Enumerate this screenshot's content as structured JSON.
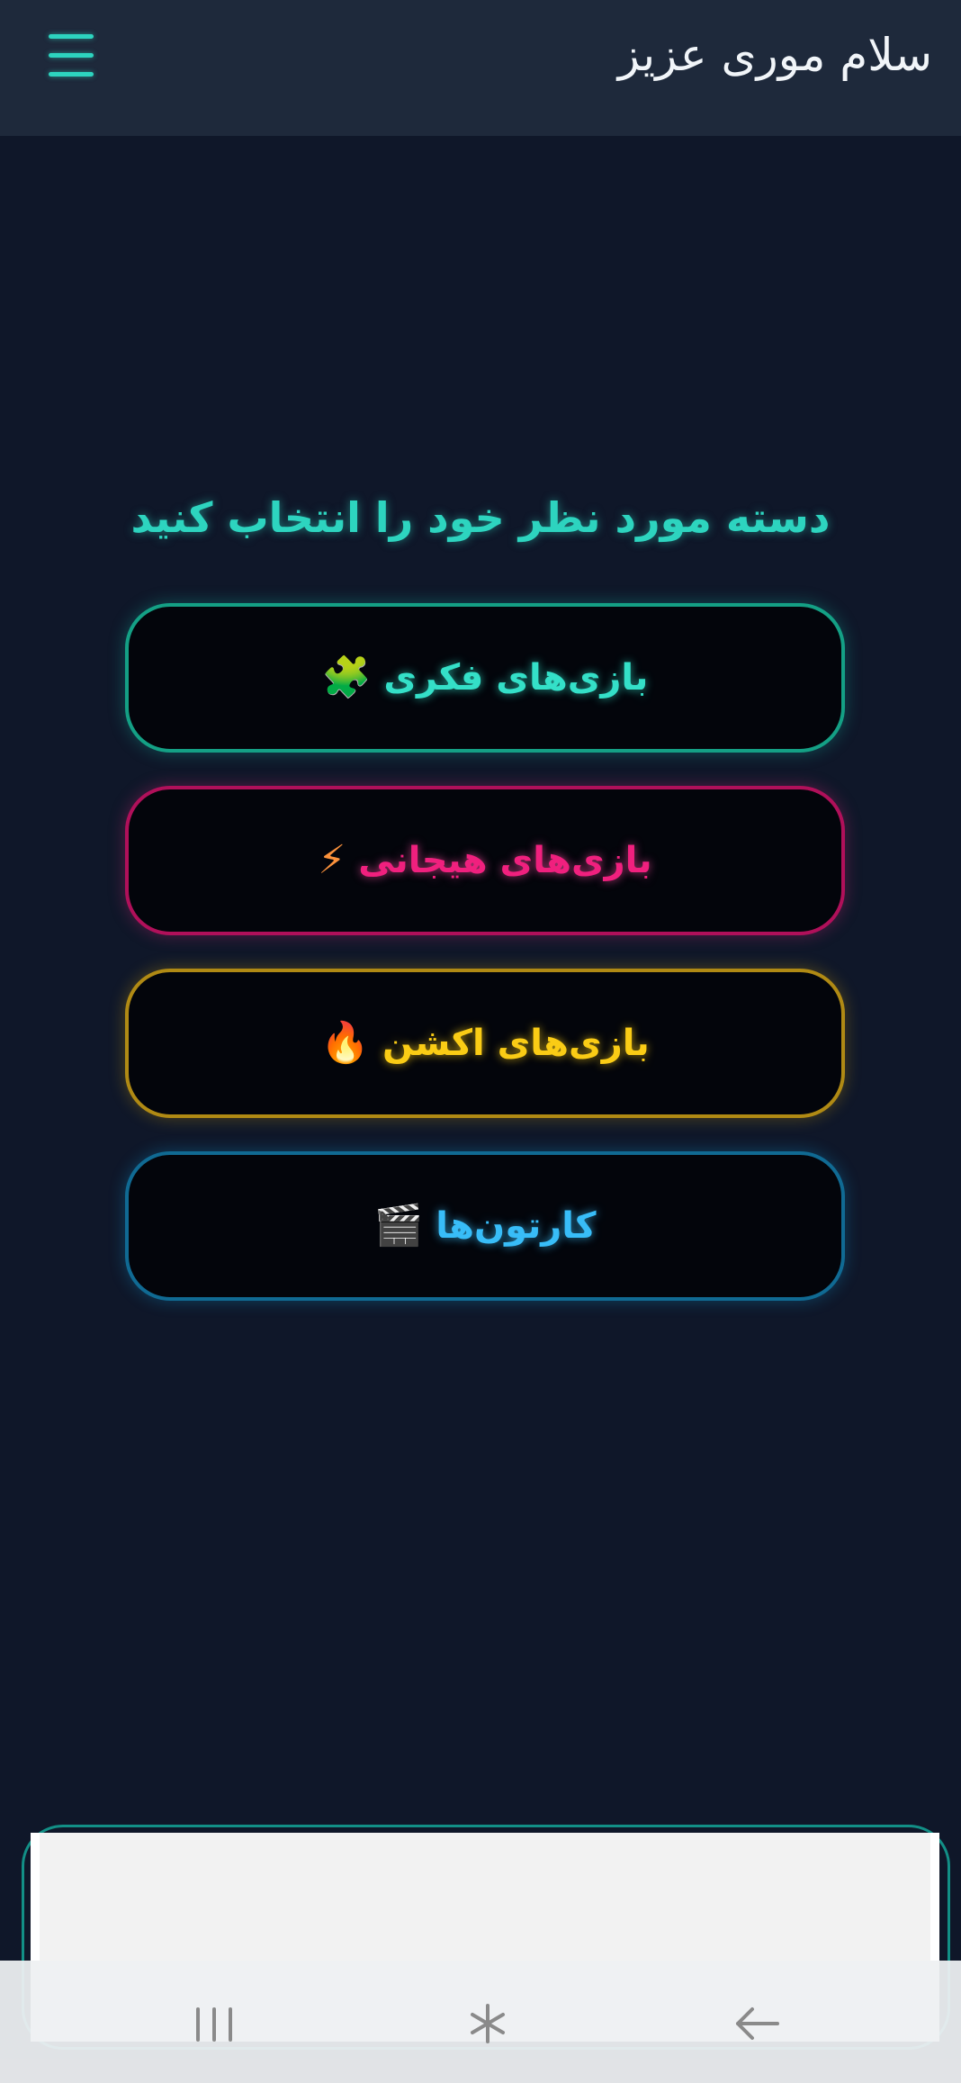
{
  "header": {
    "greeting": "سلام موری عزیز",
    "menu_icon": "hamburger-menu-icon"
  },
  "main": {
    "prompt": "دسته مورد نظر خود را انتخاب کنید",
    "categories": [
      {
        "label": "بازی‌های فکری",
        "icon": "🧩",
        "icon_name": "puzzle-icon",
        "color": "#2dd4bf",
        "border": "#14a085"
      },
      {
        "label": "بازی‌های هیجانی",
        "icon": "⚡",
        "icon_name": "lightning-icon",
        "color": "#f0207e",
        "border": "#b0105a"
      },
      {
        "label": "بازی‌های اکشن",
        "icon": "🔥",
        "icon_name": "fire-icon",
        "color": "#facc15",
        "border": "#b08a14"
      },
      {
        "label": "کارتون‌ها",
        "icon": "🎬",
        "icon_name": "clapperboard-icon",
        "color": "#38bdf8",
        "border": "#106a93"
      }
    ]
  },
  "navbar": {
    "recents_icon": "recent-apps-icon",
    "home_icon": "home-icon",
    "back_icon": "back-arrow-icon"
  },
  "colors": {
    "background": "#0f1729",
    "header_bg": "#1e293b",
    "accent": "#2dd4bf"
  }
}
